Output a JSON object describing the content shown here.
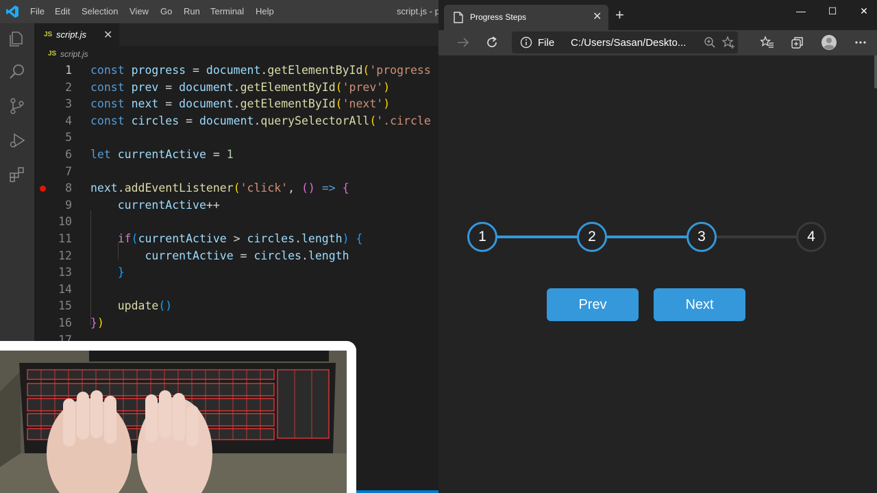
{
  "vscode": {
    "menu": [
      "File",
      "Edit",
      "Selection",
      "View",
      "Go",
      "Run",
      "Terminal",
      "Help"
    ],
    "title": "script.js - p",
    "tab": {
      "badge": "JS",
      "label": "script.js",
      "close": "✕"
    },
    "breadcrumb": {
      "badge": "JS",
      "label": "script.js"
    },
    "line_numbers": [
      "1",
      "2",
      "3",
      "4",
      "5",
      "6",
      "7",
      "8",
      "9",
      "10",
      "11",
      "12",
      "13",
      "14",
      "15",
      "16",
      "17"
    ],
    "breakpoint_line": 8,
    "active_line": 1,
    "code": [
      "const progress = document.getElementById('progress",
      "const prev = document.getElementById('prev')",
      "const next = document.getElementById('next')",
      "const circles = document.querySelectorAll('.circle",
      "",
      "let currentActive = 1",
      "",
      "next.addEventListener('click', () => {",
      "    currentActive++",
      "",
      "    if(currentActive > circles.length) {",
      "        currentActive = circles.length",
      "    }",
      "",
      "    update()",
      "})",
      ""
    ]
  },
  "browser": {
    "tab_title": "Progress Steps",
    "tab_close": "✕",
    "new_tab": "+",
    "window_controls": {
      "minimize": "—",
      "maximize": "☐",
      "close": "✕"
    },
    "address": {
      "scheme": "File",
      "url": "C:/Users/Sasan/Deskto..."
    },
    "progress": {
      "steps": [
        "1",
        "2",
        "3",
        "4"
      ],
      "active_count": 3,
      "fill_fraction": 0.667
    },
    "buttons": {
      "prev": "Prev",
      "next": "Next"
    },
    "colors": {
      "accent": "#3498db",
      "empty": "#3a3a3a",
      "page_bg": "#232323"
    }
  },
  "icons": {
    "vscode_logo": "vscode-logo-icon",
    "activity": [
      "explorer-icon",
      "search-icon",
      "source-control-icon",
      "run-debug-icon",
      "extensions-icon"
    ],
    "browser_toolbar": [
      "forward-icon",
      "refresh-icon",
      "info-icon",
      "zoom-icon",
      "favorite-add-icon",
      "favorites-icon",
      "collections-icon",
      "profile-icon",
      "more-icon"
    ],
    "page_tab": "page-icon"
  }
}
